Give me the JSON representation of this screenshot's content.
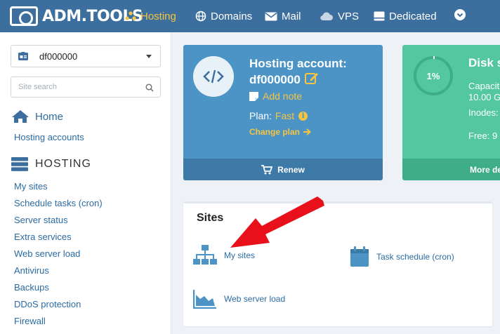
{
  "brand": {
    "name": "ADM.TOOLS"
  },
  "nav": {
    "items": [
      {
        "label": "Hosting",
        "icon": "hosting-icon",
        "active": true
      },
      {
        "label": "Domains",
        "icon": "globe-icon"
      },
      {
        "label": "Mail",
        "icon": "envelope-icon"
      },
      {
        "label": "VPS",
        "icon": "cloud-icon"
      },
      {
        "label": "Dedicated",
        "icon": "server-icon"
      }
    ],
    "more_icon": "chevron-down-icon"
  },
  "sidebar": {
    "account_selected": "df000000",
    "search_placeholder": "Site search",
    "home_label": "Home",
    "hosting_accounts_label": "Hosting accounts",
    "section_title": "HOSTING",
    "items": [
      "My sites",
      "Schedule tasks (cron)",
      "Server status",
      "Extra services",
      "Web server load",
      "Antivirus",
      "Backups",
      "DDoS protection",
      "Firewall"
    ]
  },
  "hosting_card": {
    "title": "Hosting account:",
    "account": "df000000",
    "add_note": "Add note",
    "plan_label": "Plan:",
    "plan_value": "Fast",
    "change_plan": "Change plan",
    "renew": "Renew"
  },
  "disk_card": {
    "usage_percent": "1%",
    "usage_fraction": 0.01,
    "title": "Disk s",
    "capacity_label": "Capacit",
    "capacity_value": "10.00 G",
    "inodes_label": "Inodes:",
    "free_label": "Free: 9",
    "more": "More de"
  },
  "sites": {
    "title": "Sites",
    "links": [
      {
        "label": "My sites",
        "icon": "sitemap-icon"
      },
      {
        "label": "Task schedule (cron)",
        "icon": "calendar-icon"
      },
      {
        "label": "Web server load",
        "icon": "area-chart-icon"
      }
    ]
  },
  "colors": {
    "nav_bg": "#3d6f9e",
    "accent": "#f5c542",
    "host_card": "#4d94c6",
    "disk_card": "#53c7a0",
    "link": "#2b6ba3",
    "annotation_arrow": "#e8101a"
  }
}
